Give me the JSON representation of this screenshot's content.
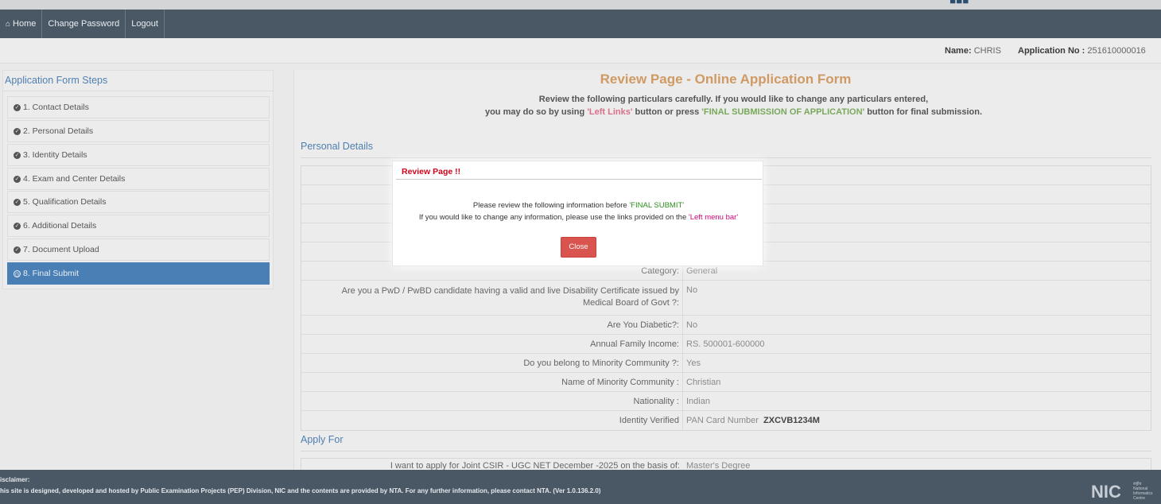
{
  "nav": {
    "home": "Home",
    "change_password": "Change Password",
    "logout": "Logout"
  },
  "info": {
    "name_label": "Name:",
    "name_value": "CHRIS",
    "app_label": "Application No :",
    "app_value": "251610000016"
  },
  "sidebar": {
    "title": "Application Form Steps",
    "steps": [
      {
        "label": "1. Contact Details"
      },
      {
        "label": "2. Personal Details"
      },
      {
        "label": "3. Identity Details"
      },
      {
        "label": "4. Exam and Center Details"
      },
      {
        "label": "5. Qualification Details"
      },
      {
        "label": "6. Additional Details"
      },
      {
        "label": "7. Document Upload"
      },
      {
        "label": "8. Final Submit",
        "active": true
      }
    ]
  },
  "main": {
    "title": "Review Page - Online Application Form",
    "sub1": "Review the following particulars carefully. If you would like to change any particulars entered,",
    "sub2_pre": "you may do so by using ",
    "sub2_red": "'Left Links'",
    "sub2_mid": " button or press ",
    "sub2_green": "'FINAL SUBMISSION OF APPLICATION'",
    "sub2_post": " button for final submission.",
    "section_personal": "Personal Details",
    "section_apply": "Apply For",
    "rows": [
      {
        "label": "Category:",
        "value": "General"
      },
      {
        "label": "Are you a PwD / PwBD candidate having a valid and live Disability Certificate issued by",
        "label2": "Medical Board of Govt ?:",
        "value": "No"
      },
      {
        "label": "Are You Diabetic?:",
        "value": "No"
      },
      {
        "label": "Annual Family Income:",
        "value": "RS. 500001-600000"
      },
      {
        "label": "Do you belong to Minority Community ?:",
        "value": "Yes"
      },
      {
        "label": "Name of Minority Community :",
        "value": "Christian"
      },
      {
        "label": "Nationality :",
        "value": "Indian"
      },
      {
        "label": "Identity Verified",
        "value": "PAN Card Number",
        "value_bold": "ZXCVB1234M"
      }
    ],
    "apply_row": {
      "label": "I want to apply for Joint CSIR - UGC NET December -2025 on the basis of:",
      "value": "Master's Degree"
    }
  },
  "modal": {
    "title": "Review Page !!",
    "line1_pre": "Please review the following information before ",
    "line1_green": "'FINAL SUBMIT'",
    "line2_pre": "If you would like to change any information, please use the links provided on the ",
    "line2_pink": "'Left menu bar'",
    "close": "Close"
  },
  "footer": {
    "disclaimer_title": "isclaimer:",
    "disclaimer_text": "his site is designed, developed and hosted by Public Examination Projects (PEP) Division, NIC and the contents are provided by NTA. For any further information, please contact NTA. (Ver 1.0.136.2.0)",
    "nic_text": "NIC",
    "nic_sub1": "राष्ट्रीय",
    "nic_sub2": "National",
    "nic_sub3": "Informatics",
    "nic_sub4": "Centre"
  }
}
